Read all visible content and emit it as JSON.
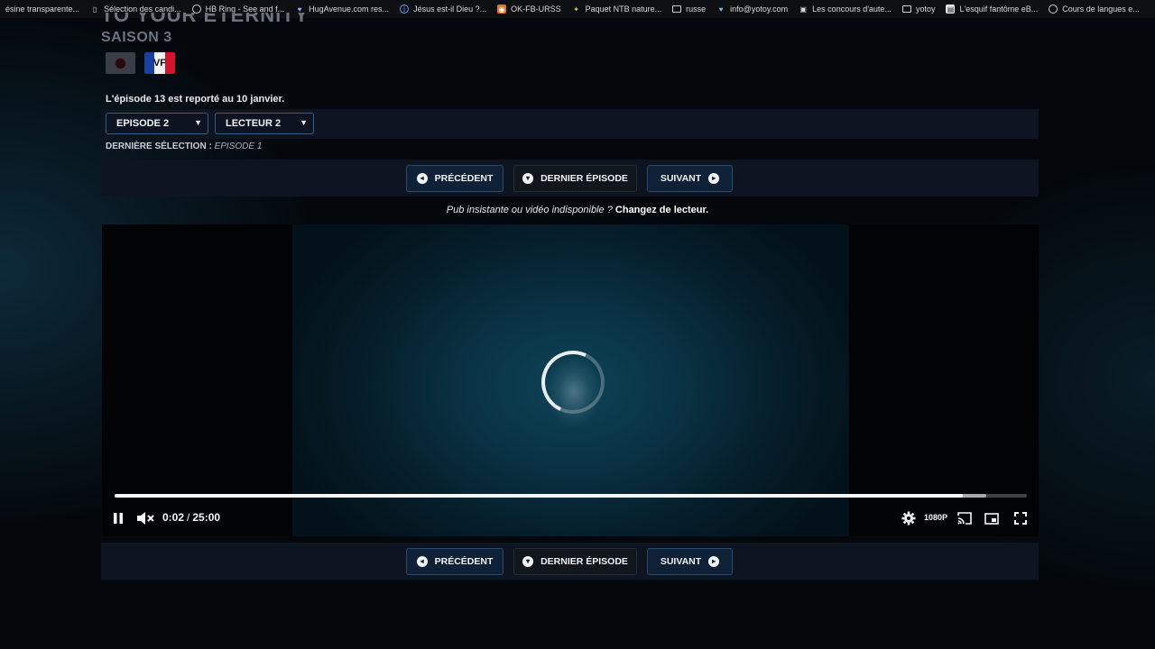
{
  "bookmarks": [
    {
      "label": "ésine transparente...",
      "icon": "none"
    },
    {
      "label": "Sélection des candi...",
      "icon": "doc-icon"
    },
    {
      "label": "HB Ring - See and f...",
      "icon": "globe-icon"
    },
    {
      "label": "HugAvenue.com res...",
      "icon": "heart-icon"
    },
    {
      "label": "Jésus est-il Dieu ?...",
      "icon": "info-icon"
    },
    {
      "label": "OK-FB-URSS",
      "icon": "rss-icon"
    },
    {
      "label": "Paquet NTB nature...",
      "icon": "leaf-icon"
    },
    {
      "label": "russe",
      "icon": "folder-icon"
    },
    {
      "label": "info@yotoy.com",
      "icon": "heart-icon"
    },
    {
      "label": "Les concours d'aute...",
      "icon": "image-icon"
    },
    {
      "label": "yotoy",
      "icon": "folder-icon"
    },
    {
      "label": "L'esquif fantôme eB...",
      "icon": "book-icon"
    },
    {
      "label": "Cours de langues e...",
      "icon": "globe-icon"
    }
  ],
  "header": {
    "title_partial": "TO YOUR ETERNITY",
    "season": "SAISON 3",
    "flag_vf_label": "VF"
  },
  "notice": "L'épisode 13 est reporté au 10 janvier.",
  "selects": {
    "episode": "EPISODE 2",
    "player": "LECTEUR 2"
  },
  "last_selection": {
    "label": "DERNIÈRE SÉLECTION :",
    "value": "EPISODE 1"
  },
  "nav": {
    "prev": "PRÉCÉDENT",
    "latest": "DERNIER ÉPISODE",
    "next": "SUIVANT"
  },
  "pub": {
    "question": "Pub insistante ou vidéo indisponible ?",
    "link": "Changez de lecteur."
  },
  "player": {
    "current_time": "0:02",
    "duration": "25:00",
    "quality": "1080P",
    "played_fraction": 0.93,
    "buffered_fraction": 0.955
  },
  "colors": {
    "accent_border": "#2c4a6e",
    "button_bg": "#0f2136",
    "panel_bg": "#0e1520"
  }
}
